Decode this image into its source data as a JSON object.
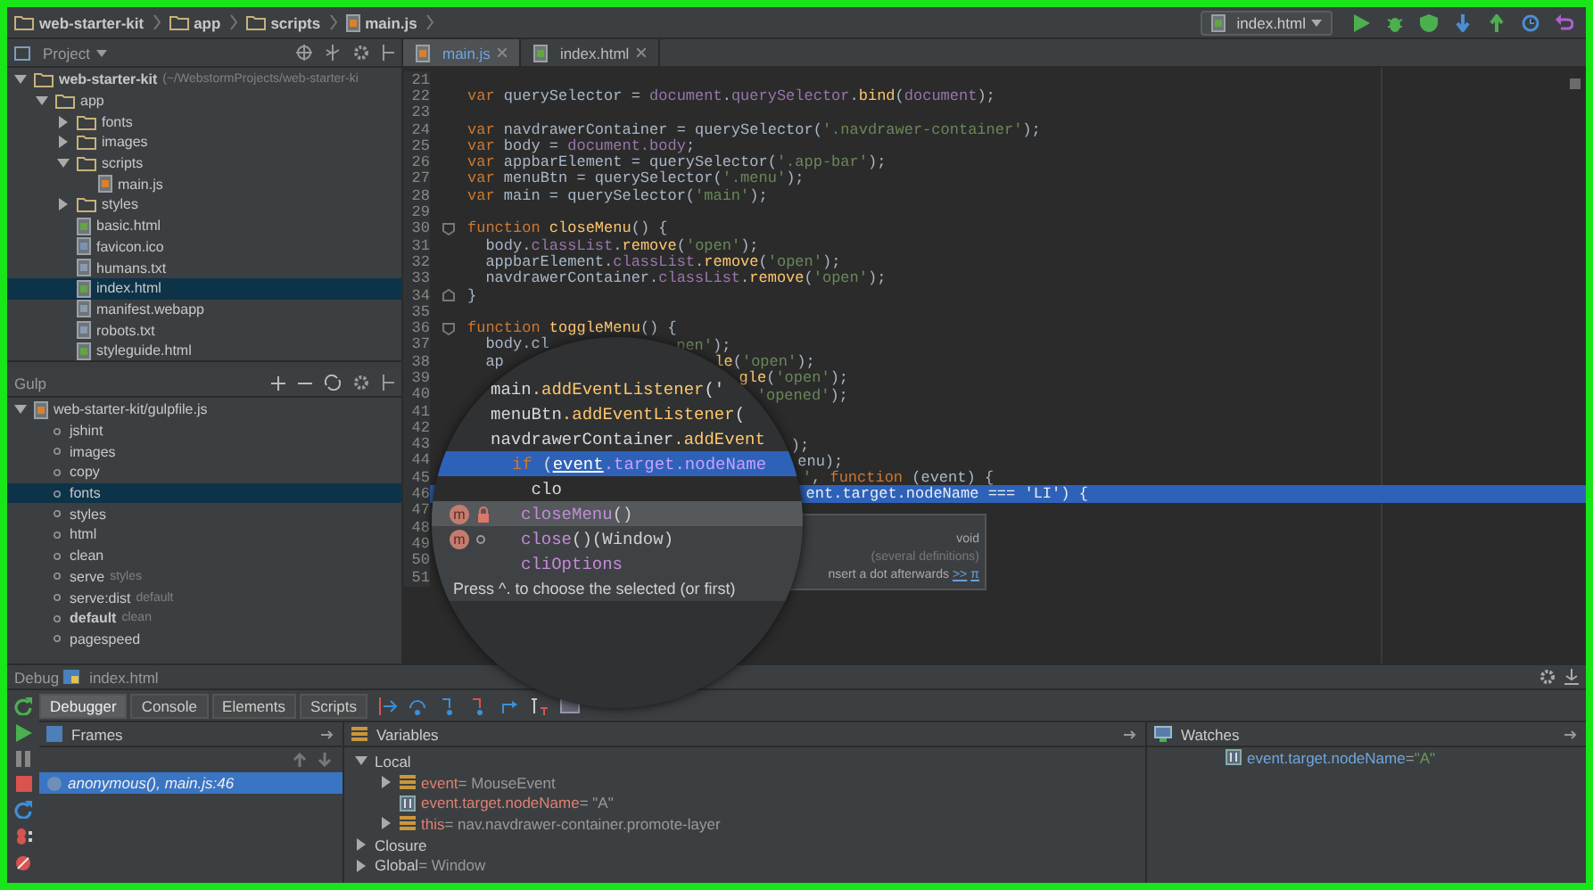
{
  "breadcrumbs": [
    {
      "label": "web-starter-kit",
      "kind": "folder"
    },
    {
      "label": "app",
      "kind": "folder"
    },
    {
      "label": "scripts",
      "kind": "folder"
    },
    {
      "label": "main.js",
      "kind": "js"
    }
  ],
  "run_config": {
    "label": "index.html"
  },
  "project_panel": {
    "title": "Project",
    "tree": [
      {
        "label": "web-starter-kit",
        "hint": "(~/WebstormProjects/web-starter-ki",
        "kind": "folder",
        "expanded": true,
        "selected": false,
        "children": [
          {
            "label": "app",
            "kind": "folder",
            "expanded": true,
            "selected": false,
            "children": [
              {
                "label": "fonts",
                "kind": "folder",
                "expanded": false,
                "selected": false
              },
              {
                "label": "images",
                "kind": "folder",
                "expanded": false,
                "selected": false
              },
              {
                "label": "scripts",
                "kind": "folder",
                "expanded": true,
                "selected": false,
                "children": [
                  {
                    "label": "main.js",
                    "kind": "js",
                    "selected": false
                  }
                ]
              },
              {
                "label": "styles",
                "kind": "folder",
                "expanded": false,
                "selected": false
              },
              {
                "label": "basic.html",
                "kind": "html",
                "selected": false
              },
              {
                "label": "favicon.ico",
                "kind": "image",
                "selected": false
              },
              {
                "label": "humans.txt",
                "kind": "text",
                "selected": false
              },
              {
                "label": "index.html",
                "kind": "html",
                "selected": true
              },
              {
                "label": "manifest.webapp",
                "kind": "text",
                "selected": false
              },
              {
                "label": "robots.txt",
                "kind": "text",
                "selected": false
              },
              {
                "label": "styleguide.html",
                "kind": "html",
                "selected": false
              }
            ]
          }
        ]
      }
    ]
  },
  "gulp_panel": {
    "title": "Gulp",
    "root": {
      "label": "web-starter-kit/gulpfile.js",
      "expanded": true
    },
    "tasks": [
      {
        "label": "jshint",
        "is_default": false,
        "selected": false
      },
      {
        "label": "images",
        "is_default": false,
        "selected": false
      },
      {
        "label": "copy",
        "is_default": false,
        "selected": false
      },
      {
        "label": "fonts",
        "is_default": false,
        "selected": true
      },
      {
        "label": "styles",
        "is_default": false,
        "selected": false
      },
      {
        "label": "html",
        "is_default": false,
        "selected": false
      },
      {
        "label": "clean",
        "is_default": false,
        "selected": false
      },
      {
        "label": "serve",
        "hint": "styles",
        "is_default": false,
        "selected": false
      },
      {
        "label": "serve:dist",
        "hint": "default",
        "is_default": false,
        "selected": false
      },
      {
        "label": "default",
        "hint": "clean",
        "is_default": true,
        "selected": false
      },
      {
        "label": "pagespeed",
        "is_default": false,
        "selected": false
      }
    ]
  },
  "editor": {
    "tabs": [
      {
        "label": "main.js",
        "kind": "js",
        "selected": true
      },
      {
        "label": "index.html",
        "kind": "html",
        "selected": false
      }
    ],
    "lines": [
      {
        "number": "21",
        "current": false
      },
      {
        "number": "22",
        "current": false,
        "tokens": [
          {
            "kind": "kw",
            "text": "var"
          },
          {
            "kind": "plain",
            "text": " querySelector = "
          },
          {
            "kind": "obj",
            "text": "document"
          },
          {
            "kind": "plain",
            "text": "."
          },
          {
            "kind": "obj",
            "text": "querySelector"
          },
          {
            "kind": "plain",
            "text": "."
          },
          {
            "kind": "fn",
            "text": "bind"
          },
          {
            "kind": "plain",
            "text": "("
          },
          {
            "kind": "obj",
            "text": "document"
          },
          {
            "kind": "plain",
            "text": ");"
          }
        ]
      },
      {
        "number": "23",
        "current": false
      },
      {
        "number": "24",
        "current": false,
        "tokens": [
          {
            "kind": "kw",
            "text": "var"
          },
          {
            "kind": "plain",
            "text": " navdrawerContainer = querySelector("
          },
          {
            "kind": "str",
            "text": "'.navdrawer-container'"
          },
          {
            "kind": "plain",
            "text": ");"
          }
        ]
      },
      {
        "number": "25",
        "current": false,
        "tokens": [
          {
            "kind": "kw",
            "text": "var"
          },
          {
            "kind": "plain",
            "text": " body = "
          },
          {
            "kind": "obj",
            "text": "document.body"
          },
          {
            "kind": "plain",
            "text": ";"
          }
        ]
      },
      {
        "number": "26",
        "current": false,
        "tokens": [
          {
            "kind": "kw",
            "text": "var"
          },
          {
            "kind": "plain",
            "text": " appbarElement = querySelector("
          },
          {
            "kind": "str",
            "text": "'.app-bar'"
          },
          {
            "kind": "plain",
            "text": ");"
          }
        ]
      },
      {
        "number": "27",
        "current": false,
        "tokens": [
          {
            "kind": "kw",
            "text": "var"
          },
          {
            "kind": "plain",
            "text": " menuBtn = querySelector("
          },
          {
            "kind": "str",
            "text": "'.menu'"
          },
          {
            "kind": "plain",
            "text": ");"
          }
        ]
      },
      {
        "number": "28",
        "current": false,
        "tokens": [
          {
            "kind": "kw",
            "text": "var"
          },
          {
            "kind": "plain",
            "text": " main = querySelector("
          },
          {
            "kind": "str",
            "text": "'main'"
          },
          {
            "kind": "plain",
            "text": ");"
          }
        ]
      },
      {
        "number": "29",
        "current": false
      },
      {
        "number": "30",
        "current": false,
        "fold_open": true,
        "tokens": [
          {
            "kind": "kw",
            "text": "function "
          },
          {
            "kind": "fn",
            "text": "closeMenu"
          },
          {
            "kind": "plain",
            "text": "() {"
          }
        ]
      },
      {
        "number": "31",
        "current": false,
        "tokens": [
          {
            "kind": "plain",
            "text": "  body."
          },
          {
            "kind": "obj",
            "text": "classList"
          },
          {
            "kind": "plain",
            "text": "."
          },
          {
            "kind": "fn",
            "text": "remove"
          },
          {
            "kind": "plain",
            "text": "("
          },
          {
            "kind": "str",
            "text": "'open'"
          },
          {
            "kind": "plain",
            "text": ");"
          }
        ]
      },
      {
        "number": "32",
        "current": false,
        "tokens": [
          {
            "kind": "plain",
            "text": "  appbarElement."
          },
          {
            "kind": "obj",
            "text": "classList"
          },
          {
            "kind": "plain",
            "text": "."
          },
          {
            "kind": "fn",
            "text": "remove"
          },
          {
            "kind": "plain",
            "text": "("
          },
          {
            "kind": "str",
            "text": "'open'"
          },
          {
            "kind": "plain",
            "text": ");"
          }
        ]
      },
      {
        "number": "33",
        "current": false,
        "tokens": [
          {
            "kind": "plain",
            "text": "  navdrawerContainer."
          },
          {
            "kind": "obj",
            "text": "classList"
          },
          {
            "kind": "plain",
            "text": "."
          },
          {
            "kind": "fn",
            "text": "remove"
          },
          {
            "kind": "plain",
            "text": "("
          },
          {
            "kind": "str",
            "text": "'open'"
          },
          {
            "kind": "plain",
            "text": ");"
          }
        ]
      },
      {
        "number": "34",
        "current": false,
        "fold_close": true,
        "tokens": [
          {
            "kind": "plain",
            "text": "}"
          }
        ]
      },
      {
        "number": "35",
        "current": false
      },
      {
        "number": "36",
        "current": false,
        "fold_open": true,
        "tokens": [
          {
            "kind": "kw",
            "text": "function "
          },
          {
            "kind": "fn",
            "text": "toggleMenu"
          },
          {
            "kind": "plain",
            "text": "() {"
          }
        ]
      },
      {
        "number": "37",
        "current": false,
        "tokens": [
          {
            "kind": "plain",
            "text": "  body.cl"
          }
        ],
        "tail": [
          {
            "kind": "str",
            "text": "pen'"
          },
          {
            "kind": "plain",
            "text": ");"
          }
        ]
      },
      {
        "number": "38",
        "current": false,
        "tokens": [
          {
            "kind": "plain",
            "text": "  ap"
          }
        ],
        "tail": [
          {
            "kind": "fn",
            "text": "le"
          },
          {
            "kind": "plain",
            "text": "("
          },
          {
            "kind": "str",
            "text": "'open'"
          },
          {
            "kind": "plain",
            "text": ");"
          }
        ]
      },
      {
        "number": "39",
        "current": false,
        "tail": [
          {
            "kind": "fn",
            "text": "gle"
          },
          {
            "kind": "plain",
            "text": "("
          },
          {
            "kind": "str",
            "text": "'open'"
          },
          {
            "kind": "plain",
            "text": ");"
          }
        ]
      },
      {
        "number": "40",
        "current": false,
        "tail": [
          {
            "kind": "str",
            "text": "'opened'"
          },
          {
            "kind": "plain",
            "text": ");"
          }
        ]
      },
      {
        "number": "41",
        "current": false
      },
      {
        "number": "42",
        "current": false
      },
      {
        "number": "43",
        "current": false,
        "tail": [
          {
            "kind": "plain",
            "text": ");"
          }
        ]
      },
      {
        "number": "44",
        "current": false,
        "tail": [
          {
            "kind": "plain",
            "text": "enu);"
          }
        ]
      },
      {
        "number": "45",
        "current": false,
        "tail": [
          {
            "kind": "str",
            "text": "'"
          },
          {
            "kind": "plain",
            "text": ", "
          },
          {
            "kind": "kw",
            "text": "function"
          },
          {
            "kind": "plain",
            "text": " (event) {"
          }
        ]
      },
      {
        "number": "46",
        "current": true,
        "tail": [
          {
            "kind": "plain",
            "text": "ent."
          },
          {
            "kind": "obj",
            "text": "target"
          },
          {
            "kind": "plain",
            "text": "."
          },
          {
            "kind": "obj",
            "text": "nodeName"
          },
          {
            "kind": "plain",
            "text": " === "
          },
          {
            "kind": "str",
            "text": "'LI'"
          },
          {
            "kind": "plain",
            "text": ") {"
          }
        ]
      },
      {
        "number": "47",
        "current": false
      },
      {
        "number": "48",
        "current": false
      },
      {
        "number": "49",
        "current": false
      },
      {
        "number": "50",
        "current": false
      },
      {
        "number": "51",
        "current": false
      }
    ],
    "lens": {
      "code_lines": [
        {
          "kind": "code",
          "tokens": [
            {
              "kind": "plain",
              "text": "main"
            },
            {
              "kind": "fn",
              "text": ".addEventListener"
            },
            {
              "kind": "plain",
              "text": "('"
            }
          ]
        },
        {
          "kind": "code",
          "tokens": [
            {
              "kind": "plain",
              "text": "menuBtn"
            },
            {
              "kind": "fn",
              "text": ".addEventListener"
            },
            {
              "kind": "plain",
              "text": "("
            }
          ]
        },
        {
          "kind": "code",
          "tokens": [
            {
              "kind": "plain",
              "text": "navdrawerContainer"
            },
            {
              "kind": "fn",
              "text": ".addEvent"
            }
          ]
        },
        {
          "kind": "current",
          "tokens": [
            {
              "kind": "kw",
              "text": "if"
            },
            {
              "kind": "plain",
              "text": " ("
            },
            {
              "kind": "param",
              "text": "event"
            },
            {
              "kind": "obj",
              "text": ".target.nodeName"
            }
          ]
        },
        {
          "kind": "typed",
          "tokens": [
            {
              "kind": "plain",
              "text": "    clo"
            }
          ]
        }
      ],
      "completions": [
        {
          "badge": "m",
          "private": true,
          "name": "closeMenu",
          "signature": "()",
          "selected": true
        },
        {
          "badge": "m",
          "private": false,
          "name": "close",
          "signature": "()",
          "owner": "(Window)",
          "selected": false
        },
        {
          "name": "cliOptions",
          "selected": false
        }
      ],
      "hint": "Press ^. to choose the selected (or first)"
    },
    "doc_popup": {
      "return_type": "void",
      "note": "(several definitions)",
      "action": "nsert a dot afterwards",
      "link": ">>",
      "link_icon": "π"
    }
  },
  "debug": {
    "title": "Debug",
    "config": "index.html",
    "tabs": [
      {
        "label": "Debugger",
        "selected": true
      },
      {
        "label": "Console",
        "selected": false
      },
      {
        "label": "Elements",
        "selected": false
      },
      {
        "label": "Scripts",
        "selected": false
      }
    ],
    "frames": {
      "title": "Frames",
      "items": [
        {
          "label": "anonymous(), main.js:46",
          "selected": true
        }
      ]
    },
    "variables": {
      "title": "Variables",
      "separator": "=",
      "tree": [
        {
          "name": "Local",
          "kind": "scope",
          "expanded": true,
          "children": [
            {
              "name": "event",
              "value": "MouseEvent",
              "kind": "object",
              "expanded": false
            },
            {
              "name": "event.target.nodeName",
              "value": "\"A\"",
              "kind": "primitive"
            },
            {
              "name": "this",
              "value": "nav.navdrawer-container.promote-layer",
              "kind": "object",
              "expanded": false
            }
          ]
        },
        {
          "name": "Closure",
          "kind": "scope",
          "expanded": false
        },
        {
          "name": "Global",
          "value": "Window",
          "kind": "scope",
          "expanded": false
        }
      ]
    },
    "watches": {
      "title": "Watches",
      "separator": "=",
      "items": [
        {
          "name": "event.target.nodeName",
          "value": "\"A\""
        }
      ]
    }
  }
}
